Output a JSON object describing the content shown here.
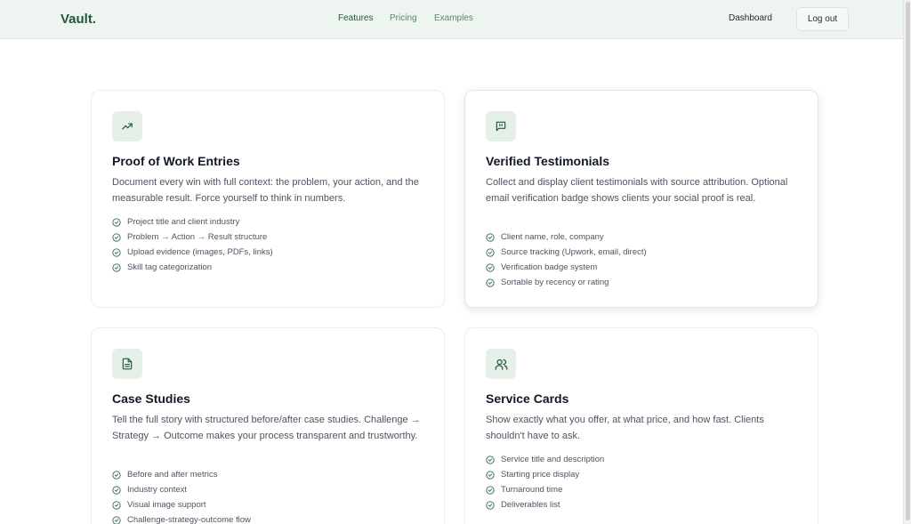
{
  "header": {
    "brand": "Vault.",
    "nav": [
      "Features",
      "Pricing",
      "Examples"
    ],
    "dashboard_label": "Dashboard",
    "logout_label": "Log out"
  },
  "colors": {
    "accent": "#1f5a34",
    "header_bg": "#eef4ef",
    "icon_bg": "#e7efe9"
  },
  "cards": [
    {
      "icon": "trending-up-icon",
      "title": "Proof of Work Entries",
      "description": "Document every win with full context: the problem, your action, and the measurable result. Force yourself to think in numbers.",
      "features": [
        "Project title and client industry",
        "Problem → Action → Result structure",
        "Upload evidence (images, PDFs, links)",
        "Skill tag categorization"
      ]
    },
    {
      "icon": "quote-message-icon",
      "title": "Verified Testimonials",
      "description": "Collect and display client testimonials with source attribution. Optional email verification badge shows clients your social proof is real.",
      "features": [
        "Client name, role, company",
        "Source tracking (Upwork, email, direct)",
        "Verification badge system",
        "Sortable by recency or rating"
      ]
    },
    {
      "icon": "document-icon",
      "title": "Case Studies",
      "description": "Tell the full story with structured before/after case studies. Challenge → Strategy → Outcome makes your process transparent and trustworthy.",
      "features": [
        "Before and after metrics",
        "Industry context",
        "Visual image support",
        "Challenge-strategy-outcome flow"
      ]
    },
    {
      "icon": "users-icon",
      "title": "Service Cards",
      "description": "Show exactly what you offer, at what price, and how fast. Clients shouldn't have to ask.",
      "features": [
        "Service title and description",
        "Starting price display",
        "Turnaround time",
        "Deliverables list"
      ]
    }
  ]
}
